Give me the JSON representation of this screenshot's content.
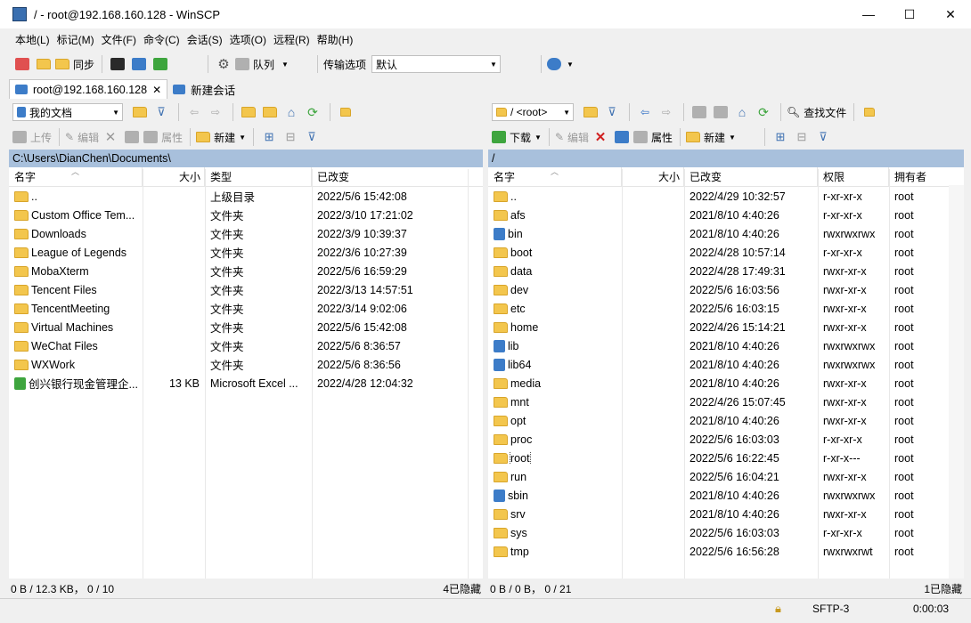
{
  "window": {
    "title": "/ - root@192.168.160.128 - WinSCP",
    "minimize": "—",
    "maximize": "☐",
    "close": "✕"
  },
  "menu": [
    "本地(L)",
    "标记(M)",
    "文件(F)",
    "命令(C)",
    "会话(S)",
    "选项(O)",
    "远程(R)",
    "帮助(H)"
  ],
  "toolbar": {
    "sync_label": "同步",
    "queue_label": "队列",
    "transfer_label": "传输选项",
    "transfer_value": "默认"
  },
  "tabs": {
    "session": "root@192.168.160.128",
    "new_session": "新建会话"
  },
  "local": {
    "location": "我的文档",
    "upload": "上传",
    "edit": "编辑",
    "properties": "属性",
    "new": "新建",
    "path": "C:\\Users\\DianChen\\Documents\\",
    "headers": {
      "name": "名字",
      "size": "大小",
      "type": "类型",
      "modified": "已改变"
    },
    "files": [
      {
        "name": "..",
        "size": "",
        "type": "上级目录",
        "modified": "2022/5/6  15:42:08"
      },
      {
        "name": "Custom Office Tem...",
        "size": "",
        "type": "文件夹",
        "modified": "2022/3/10  17:21:02"
      },
      {
        "name": "Downloads",
        "size": "",
        "type": "文件夹",
        "modified": "2022/3/9  10:39:37"
      },
      {
        "name": "League of Legends",
        "size": "",
        "type": "文件夹",
        "modified": "2022/3/6  10:27:39"
      },
      {
        "name": "MobaXterm",
        "size": "",
        "type": "文件夹",
        "modified": "2022/5/6  16:59:29"
      },
      {
        "name": "Tencent Files",
        "size": "",
        "type": "文件夹",
        "modified": "2022/3/13  14:57:51"
      },
      {
        "name": "TencentMeeting",
        "size": "",
        "type": "文件夹",
        "modified": "2022/3/14  9:02:06"
      },
      {
        "name": "Virtual Machines",
        "size": "",
        "type": "文件夹",
        "modified": "2022/5/6  15:42:08"
      },
      {
        "name": "WeChat Files",
        "size": "",
        "type": "文件夹",
        "modified": "2022/5/6  8:36:57"
      },
      {
        "name": "WXWork",
        "size": "",
        "type": "文件夹",
        "modified": "2022/5/6  8:36:56"
      },
      {
        "name": "创兴银行现金管理企...",
        "size": "13 KB",
        "type": "Microsoft Excel ...",
        "modified": "2022/4/28  12:04:32"
      }
    ],
    "status_left": "0 B / 12.3 KB，  0 / 10",
    "status_right": "4已隐藏"
  },
  "remote": {
    "location": "/  <root>",
    "download": "下载",
    "edit": "编辑",
    "properties": "属性",
    "new": "新建",
    "find": "查找文件",
    "path": "/",
    "headers": {
      "name": "名字",
      "size": "大小",
      "modified": "已改变",
      "perms": "权限",
      "owner": "拥有者"
    },
    "files": [
      {
        "name": "..",
        "modified": "2022/4/29 10:32:57",
        "perms": "r-xr-xr-x",
        "owner": "root"
      },
      {
        "name": "afs",
        "modified": "2021/8/10 4:40:26",
        "perms": "r-xr-xr-x",
        "owner": "root"
      },
      {
        "name": "bin",
        "modified": "2021/8/10 4:40:26",
        "perms": "rwxrwxrwx",
        "owner": "root"
      },
      {
        "name": "boot",
        "modified": "2022/4/28 10:57:14",
        "perms": "r-xr-xr-x",
        "owner": "root"
      },
      {
        "name": "data",
        "modified": "2022/4/28 17:49:31",
        "perms": "rwxr-xr-x",
        "owner": "root"
      },
      {
        "name": "dev",
        "modified": "2022/5/6 16:03:56",
        "perms": "rwxr-xr-x",
        "owner": "root"
      },
      {
        "name": "etc",
        "modified": "2022/5/6 16:03:15",
        "perms": "rwxr-xr-x",
        "owner": "root"
      },
      {
        "name": "home",
        "modified": "2022/4/26 15:14:21",
        "perms": "rwxr-xr-x",
        "owner": "root"
      },
      {
        "name": "lib",
        "modified": "2021/8/10 4:40:26",
        "perms": "rwxrwxrwx",
        "owner": "root"
      },
      {
        "name": "lib64",
        "modified": "2021/8/10 4:40:26",
        "perms": "rwxrwxrwx",
        "owner": "root"
      },
      {
        "name": "media",
        "modified": "2021/8/10 4:40:26",
        "perms": "rwxr-xr-x",
        "owner": "root"
      },
      {
        "name": "mnt",
        "modified": "2022/4/26 15:07:45",
        "perms": "rwxr-xr-x",
        "owner": "root"
      },
      {
        "name": "opt",
        "modified": "2021/8/10 4:40:26",
        "perms": "rwxr-xr-x",
        "owner": "root"
      },
      {
        "name": "proc",
        "modified": "2022/5/6 16:03:03",
        "perms": "r-xr-xr-x",
        "owner": "root"
      },
      {
        "name": "root",
        "modified": "2022/5/6 16:22:45",
        "perms": "r-xr-x---",
        "owner": "root"
      },
      {
        "name": "run",
        "modified": "2022/5/6 16:04:21",
        "perms": "rwxr-xr-x",
        "owner": "root"
      },
      {
        "name": "sbin",
        "modified": "2021/8/10 4:40:26",
        "perms": "rwxrwxrwx",
        "owner": "root"
      },
      {
        "name": "srv",
        "modified": "2021/8/10 4:40:26",
        "perms": "rwxr-xr-x",
        "owner": "root"
      },
      {
        "name": "sys",
        "modified": "2022/5/6 16:03:03",
        "perms": "r-xr-xr-x",
        "owner": "root"
      },
      {
        "name": "tmp",
        "modified": "2022/5/6 16:56:28",
        "perms": "rwxrwxrwt",
        "owner": "root"
      }
    ],
    "status_left": "0 B / 0 B，  0 / 21",
    "status_right": "1已隐藏"
  },
  "bottom": {
    "protocol": "SFTP-3",
    "timer": "0:00:03"
  }
}
